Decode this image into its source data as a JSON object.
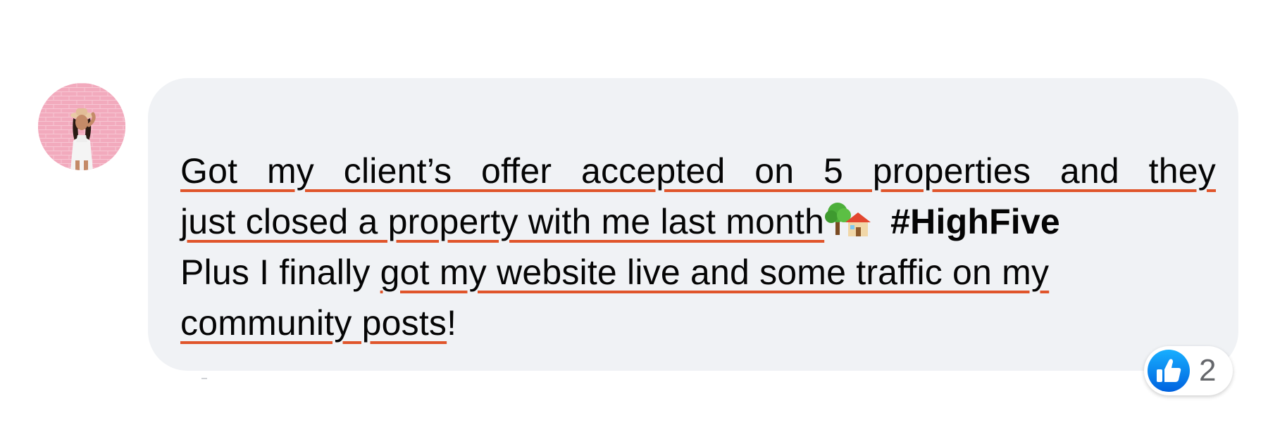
{
  "comment": {
    "avatar_icon": "profile-avatar",
    "lines": {
      "l1_underlined": "Got my client’s offer accepted on 5 properties and they",
      "l2_underlined": "just closed a property with me last month",
      "l2_hashtag": "#HighFive",
      "l3_plain": "Plus I finally ",
      "l3_underlined": "got my website live and some traffic on my",
      "l4_underlined": "community posts",
      "l4_plain": "!"
    },
    "emoji": "tree-and-house-emoji",
    "underline_color": "#e0552b",
    "bubble_color": "#f0f2f5",
    "text_color": "#050505"
  },
  "reactions": {
    "icon": "like-thumbs-up-icon",
    "count": "2",
    "like_color": "#1877f2"
  }
}
